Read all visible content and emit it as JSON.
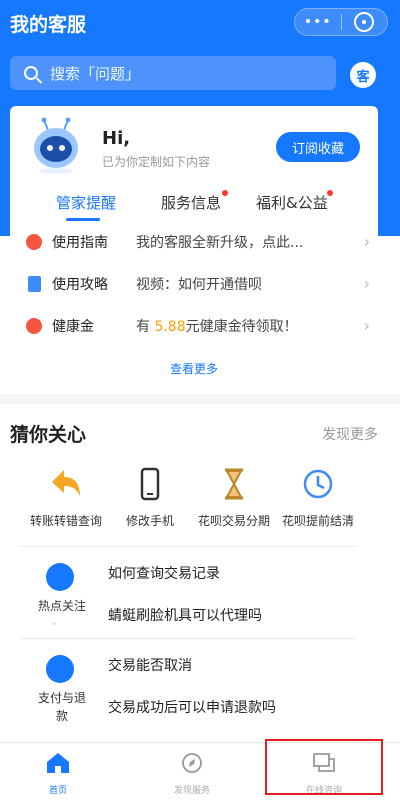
{
  "header": {
    "title": "我的客服",
    "menu_glyph": "•••",
    "close_icon": "target-icon",
    "search_placeholder": "搜索「问题」",
    "search_aside": "客"
  },
  "card": {
    "greeting": "Hi,",
    "subtitle": "已为你定制如下内容",
    "subscribe_button": "订阅收藏",
    "tabs": [
      {
        "label": "管家提醒",
        "active": true,
        "dot": false
      },
      {
        "label": "服务信息",
        "active": false,
        "dot": true
      },
      {
        "label": "福利&公益",
        "active": false,
        "dot": true
      }
    ],
    "rows": [
      {
        "label": "使用指南",
        "text": "我的客服全新升级，点此...",
        "icon": "compass-icon",
        "color": "#f5553b"
      },
      {
        "label": "使用攻略",
        "text": "视频：如何开通借呗",
        "icon": "document-icon",
        "color": "#3d8cfa"
      },
      {
        "label": "健康金",
        "text_before": "有 ",
        "highlight": "5.88",
        "text_after": "元健康金待领取！",
        "icon": "health-icon",
        "color": "#f5553b",
        "highlight_color": "#ff9f00"
      }
    ],
    "more": "查看更多"
  },
  "section": {
    "title": "猜你关心",
    "more": "发现更多",
    "quick_actions": [
      {
        "label": "转账转错查询",
        "icon": "undo-arrow-icon"
      },
      {
        "label": "修改手机",
        "icon": "phone-icon"
      },
      {
        "label": "花呗交易分期",
        "icon": "hourglass-icon"
      },
      {
        "label": "花呗提前结清",
        "icon": "clock-icon"
      }
    ],
    "hot": [
      {
        "category": "热点关注",
        "icon": "agent-icon",
        "questions": [
          "如何查询交易记录",
          "蜻蜓刷脸机具可以代理吗"
        ]
      },
      {
        "category": "支付与退款",
        "icon": "bag-icon",
        "questions": [
          "交易能否取消",
          "交易成功后可以申请退款吗"
        ]
      }
    ]
  },
  "tabbar": {
    "items": [
      {
        "label": "首页",
        "icon": "home-icon",
        "active": true
      },
      {
        "label": "发现服务",
        "icon": "compass-icon",
        "active": false
      },
      {
        "label": "在线咨询",
        "icon": "chat-icon",
        "active": false
      }
    ]
  },
  "colors": {
    "brand": "#1677ff",
    "alert": "#e02020"
  }
}
